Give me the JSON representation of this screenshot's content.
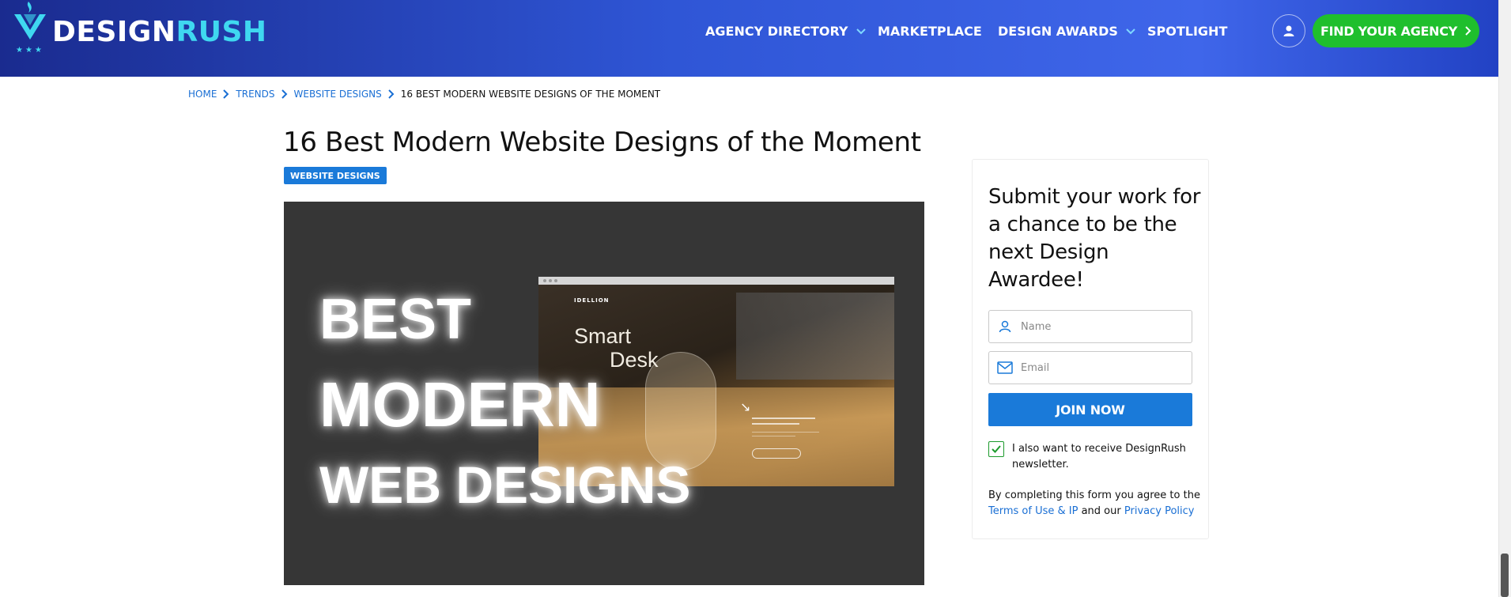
{
  "header": {
    "logo_part1": "DESIGN",
    "logo_part2": "RUSH",
    "nav": [
      {
        "label": "AGENCY DIRECTORY",
        "has_dropdown": true
      },
      {
        "label": "MARKETPLACE",
        "has_dropdown": false
      },
      {
        "label": "DESIGN AWARDS",
        "has_dropdown": true
      },
      {
        "label": "SPOTLIGHT",
        "has_dropdown": false
      }
    ],
    "user_icon": "user-icon",
    "cta_label": "FIND YOUR AGENCY",
    "cta_icon": "chevron-right-icon"
  },
  "breadcrumb": {
    "items": [
      "HOME",
      "TRENDS",
      "WEBSITE DESIGNS"
    ],
    "current": "16 BEST MODERN WEBSITE DESIGNS OF THE MOMENT"
  },
  "article": {
    "title": "16 Best Modern Website Designs of the Moment",
    "tag": "WEBSITE DESIGNS",
    "hero": {
      "line1": "BEST",
      "line2": "MODERN",
      "line3": "WEB DESIGNS",
      "mockup_brand": "IDELLION",
      "mockup_word1": "Smart",
      "mockup_word2": "Desk"
    }
  },
  "sidebar": {
    "title": "Submit your work for a chance to be the next Design Awardee!",
    "name_placeholder": "Name",
    "email_placeholder": "Email",
    "join_label": "JOIN NOW",
    "newsletter_checked": true,
    "newsletter_label": "I also want to receive DesignRush newsletter.",
    "legal_prefix": "By completing this form you agree to the",
    "terms_link": "Terms of Use & IP",
    "legal_and": "and our",
    "privacy_link": "Privacy Policy"
  },
  "colors": {
    "header_gradient_start": "#1a2b8f",
    "header_gradient_end": "#3f66ea",
    "cta_green": "#1fbf2d",
    "accent_blue": "#1a7ad9",
    "logo_cyan": "#3fd8f0"
  }
}
